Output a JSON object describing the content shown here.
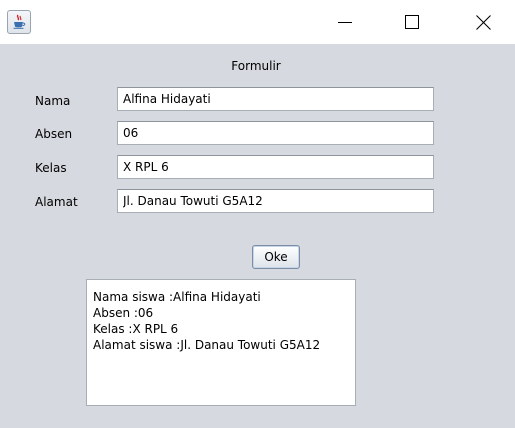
{
  "window": {
    "icon": "java-cup-icon",
    "controls": {
      "minimize": "minimize-icon",
      "maximize": "maximize-icon",
      "close": "close-icon"
    }
  },
  "form": {
    "title": "Formulir",
    "fields": [
      {
        "label": "Nama",
        "value": "Alfina Hidayati"
      },
      {
        "label": "Absen",
        "value": "06"
      },
      {
        "label": "Kelas",
        "value": "X RPL 6"
      },
      {
        "label": "Alamat",
        "value": "Jl. Danau Towuti G5A12"
      }
    ],
    "ok_label": "Oke"
  },
  "output": {
    "lines": [
      "Nama siswa :Alfina Hidayati",
      "Absen :06",
      "Kelas :X RPL 6",
      "Alamat siswa :Jl. Danau Towuti G5A12"
    ]
  },
  "colors": {
    "background": "#d6d9df",
    "titlebar": "#ffffff",
    "field_border": "#a8aeb6"
  }
}
